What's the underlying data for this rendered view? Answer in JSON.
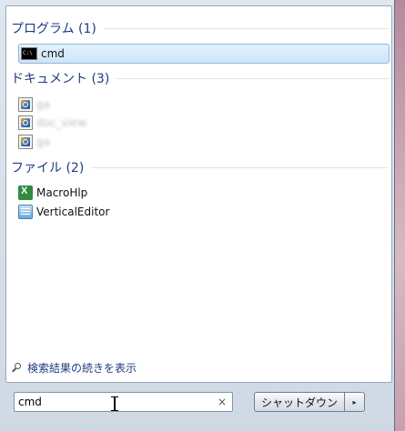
{
  "sections": {
    "programs": {
      "title": "プログラム (1)",
      "items": [
        {
          "label": "cmd",
          "icon": "cmd-icon"
        }
      ]
    },
    "documents": {
      "title": "ドキュメント (3)",
      "items": [
        {
          "label": "ga",
          "icon": "document-icon"
        },
        {
          "label": "doc_view",
          "icon": "document-icon"
        },
        {
          "label": "ga",
          "icon": "document-icon"
        }
      ]
    },
    "files": {
      "title": "ファイル (2)",
      "items": [
        {
          "label": "MacroHlp",
          "icon": "excel-icon"
        },
        {
          "label": "VerticalEditor",
          "icon": "editor-icon"
        }
      ]
    }
  },
  "more_results": "検索結果の続きを表示",
  "search": {
    "value": "cmd",
    "clear_glyph": "×"
  },
  "shutdown": {
    "label": "シャットダウン",
    "arrow_glyph": "▸"
  }
}
